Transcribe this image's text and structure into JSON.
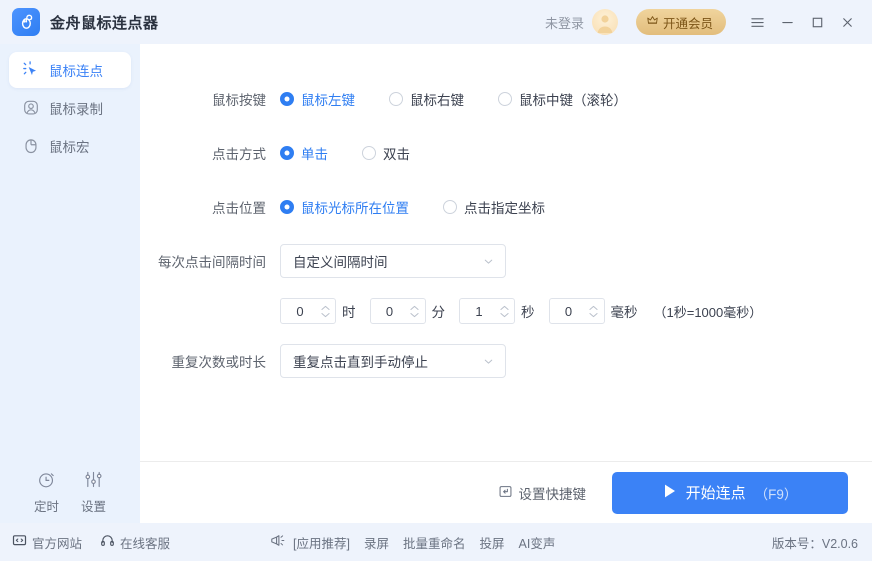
{
  "titlebar": {
    "app_title": "金舟鼠标连点器",
    "login_text": "未登录",
    "vip_button": "开通会员",
    "menu_icon": "hamburger-menu-icon",
    "minimize_icon": "minimize-icon",
    "maximize_icon": "maximize-icon",
    "close_icon": "close-icon",
    "logo_icon": "mouse-app-logo-icon",
    "avatar_icon": "user-avatar-icon",
    "vip_icon": "crown-icon"
  },
  "sidebar": {
    "items": [
      {
        "label": "鼠标连点",
        "icon": "click-cursor-icon",
        "active": true
      },
      {
        "label": "鼠标录制",
        "icon": "record-camera-icon",
        "active": false
      },
      {
        "label": "鼠标宏",
        "icon": "mouse-macro-icon",
        "active": false
      }
    ],
    "tools": [
      {
        "label": "定时",
        "icon": "stopwatch-icon"
      },
      {
        "label": "设置",
        "icon": "sliders-settings-icon"
      }
    ]
  },
  "form": {
    "mouse_button": {
      "label": "鼠标按键",
      "options": [
        "鼠标左键",
        "鼠标右键",
        "鼠标中键（滚轮）"
      ],
      "selected": 0
    },
    "click_mode": {
      "label": "点击方式",
      "options": [
        "单击",
        "双击"
      ],
      "selected": 0
    },
    "click_position": {
      "label": "点击位置",
      "options": [
        "鼠标光标所在位置",
        "点击指定坐标"
      ],
      "selected": 0
    },
    "interval": {
      "label": "每次点击间隔时间",
      "value": "自定义间隔时间",
      "chevron_icon": "chevron-down-icon"
    },
    "time_fields": [
      {
        "value": "0",
        "unit": "时"
      },
      {
        "value": "0",
        "unit": "分"
      },
      {
        "value": "1",
        "unit": "秒"
      },
      {
        "value": "0",
        "unit": "毫秒"
      }
    ],
    "time_hint": "（1秒=1000毫秒）",
    "repeat": {
      "label": "重复次数或时长",
      "value": "重复点击直到手动停止",
      "chevron_icon": "chevron-down-icon"
    }
  },
  "actions": {
    "shortcut_label": "设置快捷键",
    "shortcut_icon": "keyboard-shortcut-icon",
    "start_label": "开始连点",
    "start_hotkey": "（F9）",
    "start_icon": "play-triangle-icon"
  },
  "statusbar": {
    "website": "官方网站",
    "website_icon": "monitor-code-icon",
    "support": "在线客服",
    "support_icon": "headset-icon",
    "promo_icon": "megaphone-icon",
    "promo_label": "[应用推荐]",
    "links": [
      "录屏",
      "批量重命名",
      "投屏",
      "AI变声"
    ],
    "version": "版本号：V2.0.6"
  },
  "colors": {
    "accent": "#3b82f6",
    "accent_strong": "#2f7ef2",
    "sidebar_bg": "#eaf2fd",
    "titlebar_bg": "#eef3fc",
    "vip_gold": "#e2bd7c",
    "text_muted": "#6b7382"
  }
}
